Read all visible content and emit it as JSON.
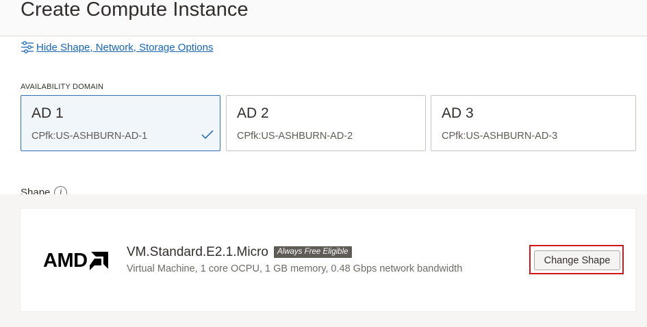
{
  "header": {
    "title": "Create Compute Instance"
  },
  "options_toggle": {
    "label": "Hide Shape, Network, Storage Options",
    "icon": "sliders-icon"
  },
  "availability_domain": {
    "section_label": "AVAILABILITY DOMAIN",
    "selected_index": 0,
    "domains": [
      {
        "name": "AD 1",
        "id": "CPfk:US-ASHBURN-AD-1",
        "selected": true
      },
      {
        "name": "AD 2",
        "id": "CPfk:US-ASHBURN-AD-2",
        "selected": false
      },
      {
        "name": "AD 3",
        "id": "CPfk:US-ASHBURN-AD-3",
        "selected": false
      }
    ]
  },
  "shape": {
    "section_label": "Shape",
    "vendor_logo": "AMD",
    "name": "VM.Standard.E2.1.Micro",
    "badge": "Always Free Eligible",
    "description": "Virtual Machine, 1 core OCPU, 1 GB memory, 0.48 Gbps network bandwidth",
    "change_button_label": "Change Shape"
  },
  "colors": {
    "link": "#1765b3",
    "selected_border": "#2f6fb2",
    "selected_bg": "#f1f6fb",
    "highlight": "#d2141b",
    "badge_bg": "#5f5b57"
  }
}
